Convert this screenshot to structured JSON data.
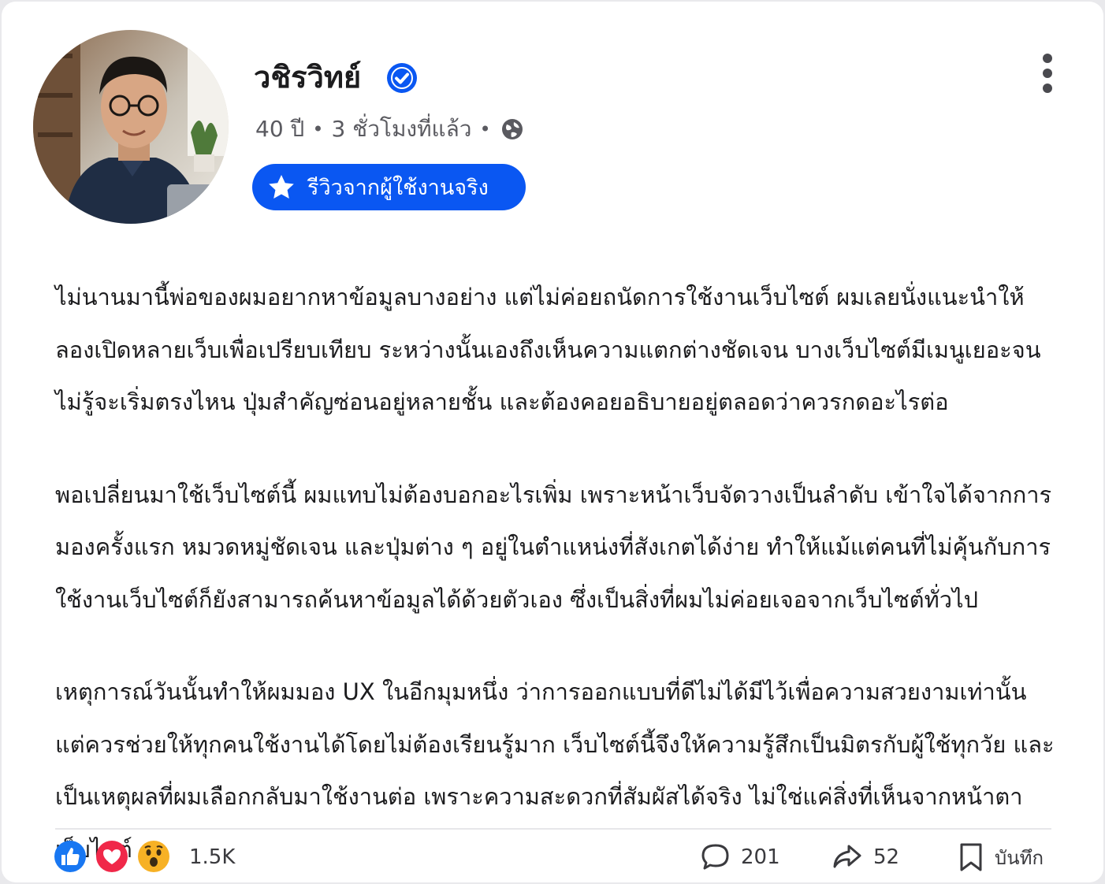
{
  "post": {
    "author_name": "วชิรวิทย์",
    "age": "40 ปี",
    "time_ago": "3 ชั่วโมงที่แล้ว",
    "separator": "•",
    "badge_label": "รีวิวจากผู้ใช้งานจริง",
    "paragraphs": [
      "ไม่นานมานี้พ่อของผมอยากหาข้อมูลบางอย่าง แต่ไม่ค่อยถนัดการใช้งานเว็บไซต์ ผมเลยนั่งแนะนำให้ลองเปิดหลายเว็บเพื่อเปรียบเทียบ ระหว่างนั้นเองถึงเห็นความแตกต่างชัดเจน บางเว็บไซต์มีเมนูเยอะจนไม่รู้จะเริ่มตรงไหน ปุ่มสำคัญซ่อนอยู่หลายชั้น และต้องคอยอธิบายอยู่ตลอดว่าควรกดอะไรต่อ",
      "พอเปลี่ยนมาใช้เว็บไซต์นี้ ผมแทบไม่ต้องบอกอะไรเพิ่ม เพราะหน้าเว็บจัดวางเป็นลำดับ เข้าใจได้จากการมองครั้งแรก หมวดหมู่ชัดเจน และปุ่มต่าง ๆ อยู่ในตำแหน่งที่สังเกตได้ง่าย ทำให้แม้แต่คนที่ไม่คุ้นกับการใช้งานเว็บไซต์ก็ยังสามารถค้นหาข้อมูลได้ด้วยตัวเอง ซึ่งเป็นสิ่งที่ผมไม่ค่อยเจอจากเว็บไซต์ทั่วไป",
      "เหตุการณ์วันนั้นทำให้ผมมอง UX ในอีกมุมหนึ่ง ว่าการออกแบบที่ดีไม่ได้มีไว้เพื่อความสวยงามเท่านั้น แต่ควรช่วยให้ทุกคนใช้งานได้โดยไม่ต้องเรียนรู้มาก เว็บไซต์นี้จึงให้ความรู้สึกเป็นมิตรกับผู้ใช้ทุกวัย และเป็นเหตุผลที่ผมเลือกกลับมาใช้งานต่อ เพราะความสะดวกที่สัมผัสได้จริง ไม่ใช่แค่สิ่งที่เห็นจากหน้าตาเว็บไซต์"
    ]
  },
  "footer": {
    "reactions": [
      "like-icon",
      "love-icon",
      "wow-icon"
    ],
    "reaction_count": "1.5K",
    "comment_count": "201",
    "share_count": "52",
    "save_label": "บันทึก"
  },
  "colors": {
    "accent": "#0a57f2",
    "like": "#1877f2",
    "love": "#f02849",
    "wow": "#f7b125"
  }
}
